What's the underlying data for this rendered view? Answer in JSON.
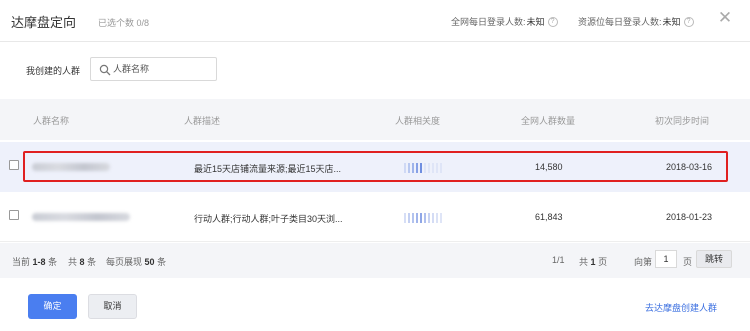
{
  "header": {
    "title": "达摩盘定向",
    "selected_count": "已选个数 0/8",
    "stat1_label": "全网每日登录人数:",
    "stat1_value": "未知",
    "stat2_label": "资源位每日登录人数:",
    "stat2_value": "未知",
    "help_glyph": "?",
    "close_glyph": "✕"
  },
  "filter": {
    "label": "我创建的人群",
    "search_placeholder": "人群名称",
    "search_value": ""
  },
  "table": {
    "columns": [
      "人群名称",
      "人群描述",
      "人群相关度",
      "全网人群数量",
      "初次同步时间"
    ],
    "rows": [
      {
        "name": "",
        "description": "最近15天店铺流量来源;最近15天店...",
        "relevance_colors": [
          "#cfd9f5",
          "#b8c8f0",
          "#9fb4eb",
          "#87a1e6",
          "#6f8ee0",
          "#dfe5f7",
          "#dfe5f7",
          "#dfe5f7",
          "#dfe5f7",
          "#dfe5f7"
        ],
        "audience_size": "14,580",
        "first_sync": "2018-03-16",
        "highlighted": true
      },
      {
        "name": "",
        "description": "行动人群;行动人群;叶子类目30天浏...",
        "relevance_colors": [
          "#d6def6",
          "#c4d0f2",
          "#b3c3ef",
          "#a2b5eb",
          "#90a7e7",
          "#b0c0ee",
          "#c8d3f3",
          "#d4dcf5",
          "#dbe2f6",
          "#dfe5f7"
        ],
        "audience_size": "61,843",
        "first_sync": "2018-01-23",
        "highlighted": false
      }
    ]
  },
  "pagination": {
    "current_prefix": "当前",
    "current_range": "1-8",
    "current_suffix": "条",
    "total_prefix": "共",
    "total_count": "8",
    "total_suffix": "条",
    "per_page_prefix": "每页展现",
    "per_page": "50",
    "per_page_suffix": "条",
    "page_status": "1/1",
    "pages_prefix": "共",
    "pages_count": "1",
    "pages_suffix": "页",
    "goto_prefix": "向第",
    "goto_value": "1",
    "goto_suffix": "页",
    "jump_label": "跳转"
  },
  "actions": {
    "ok_label": "确定",
    "cancel_label": "取消",
    "create_link": "去达摩盘创建人群"
  },
  "colors": {
    "primary": "#4a7ef0",
    "highlight_border": "#e02020",
    "link": "#3b6fe0"
  }
}
